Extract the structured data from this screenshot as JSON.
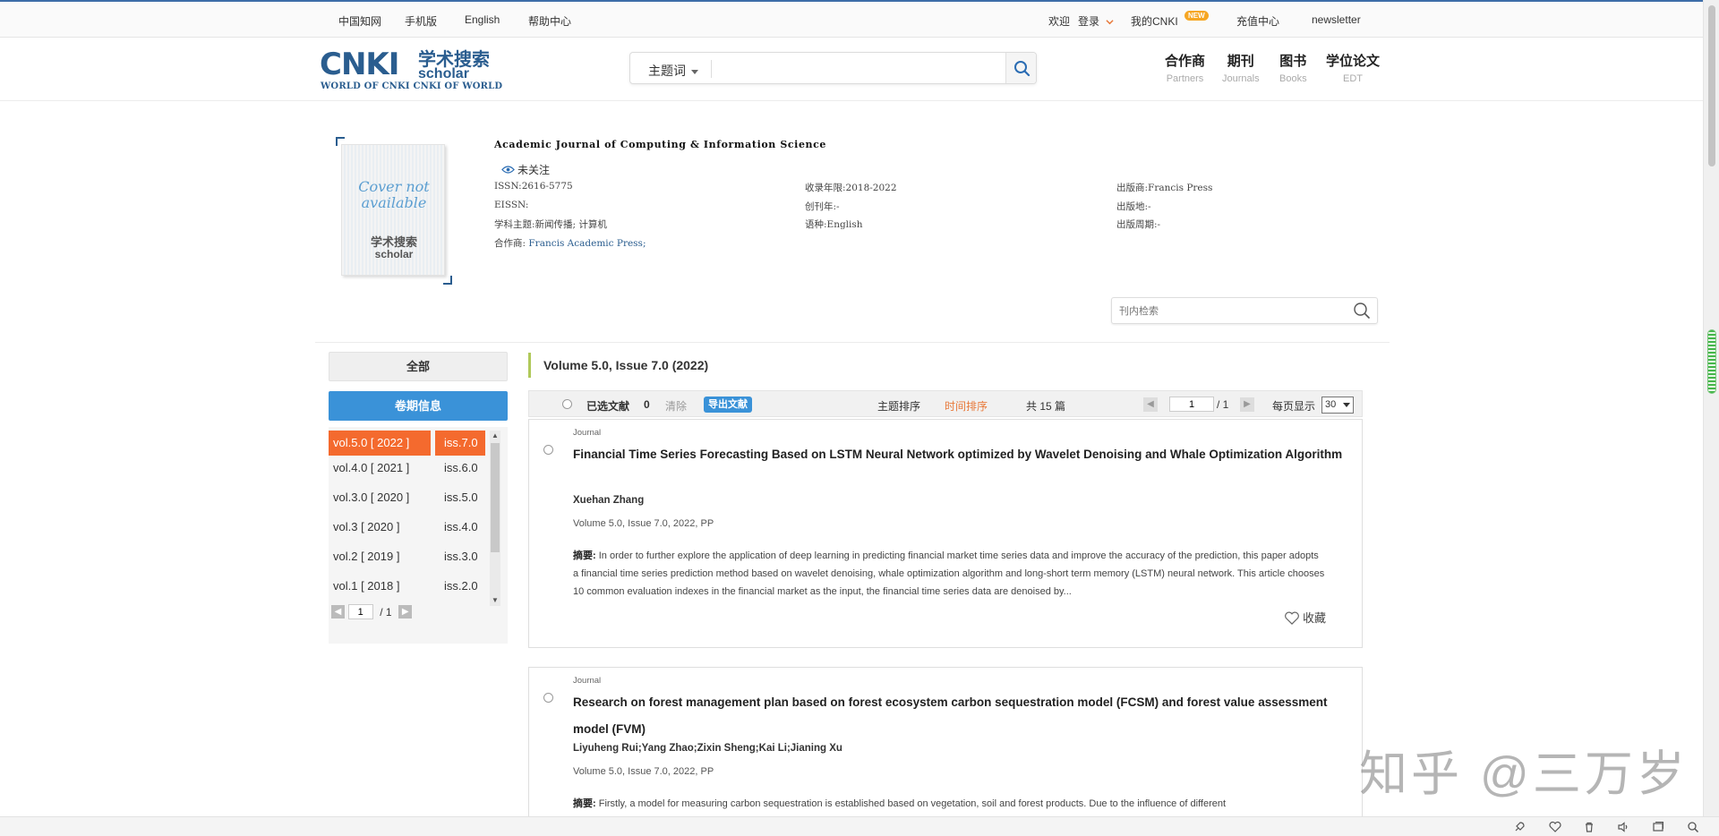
{
  "topbar": {
    "links": [
      "中国知网",
      "手机版",
      "English",
      "帮助中心"
    ],
    "welcome": "欢迎",
    "login": "登录",
    "my_cnki": "我的CNKI",
    "new_badge": "NEW",
    "recharge": "充值中心",
    "newsletter": "newsletter"
  },
  "header": {
    "logo_main": "CNKI",
    "logo_cn": "学术搜索",
    "logo_scholar": "scholar",
    "logo_sub": "WORLD OF CNKI CNKI OF WORLD",
    "search_type": "主题词",
    "search_value": "",
    "nav": [
      {
        "cn": "合作商",
        "en": "Partners"
      },
      {
        "cn": "期刊",
        "en": "Journals"
      },
      {
        "cn": "图书",
        "en": "Books"
      },
      {
        "cn": "学位论文",
        "en": "EDT"
      }
    ]
  },
  "journal": {
    "cover_text": "Cover not available",
    "cover_logo_cn": "学术搜索",
    "cover_logo_en": "scholar",
    "title": "Academic Journal of Computing & Information Science",
    "follow": "未关注",
    "issn": "ISSN:2616-5775",
    "eissn": "EISSN:",
    "subject": "学科主题:新闻传播; 计算机",
    "partner_label": "合作商:",
    "partner_value": "Francis Academic Press;",
    "years": "收录年限:2018-2022",
    "founded": "创刊年:-",
    "language": "语种:English",
    "publisher": "出版商:Francis Press",
    "place": "出版地:-",
    "period": "出版周期:-",
    "inner_search_placeholder": "刊内检索"
  },
  "sidebar": {
    "all": "全部",
    "info": "卷期信息",
    "volumes": [
      "vol.5.0 [ 2022 ]",
      "vol.4.0 [ 2021 ]",
      "vol.3.0 [ 2020 ]",
      "vol.3 [ 2020 ]",
      "vol.2 [ 2019 ]",
      "vol.1 [ 2018 ]"
    ],
    "issues": [
      "iss.7.0",
      "iss.6.0",
      "iss.5.0",
      "iss.4.0",
      "iss.3.0",
      "iss.2.0"
    ],
    "page_current": "1",
    "page_total": "/ 1"
  },
  "main": {
    "volume_heading": "Volume 5.0, Issue 7.0 (2022)",
    "toolbar": {
      "selected_label": "已选文献",
      "selected_count": "0",
      "clear": "清除",
      "export": "导出文献",
      "sort_topic": "主题排序",
      "sort_time": "时间排序",
      "total": "共 15 篇",
      "page_current": "1",
      "page_total": "/ 1",
      "per_page_label": "每页显示",
      "per_page_value": "30"
    },
    "articles": [
      {
        "type": "Journal",
        "title": "Financial Time Series Forecasting Based on LSTM Neural Network optimized by Wavelet Denoising and Whale Optimization Algorithm",
        "authors": "Xuehan Zhang",
        "volume_info": "Volume 5.0, Issue 7.0, 2022, PP",
        "abstract_label": "摘要:",
        "abstract": " In order to further explore the application of deep learning in predicting financial market time series data and improve the accuracy of the prediction, this paper adopts a financial time series prediction method based on wavelet denoising, whale optimization algorithm and long-short term memory (LSTM) neural network. This article chooses 10 common evaluation indexes in the financial market as the input, the financial time series data are denoised by...",
        "fav": "收藏"
      },
      {
        "type": "Journal",
        "title": "Research on forest management plan based on forest ecosystem carbon sequestration model (FCSM) and forest value assessment model (FVM)",
        "authors": "Liyuheng Rui;Yang Zhao;Zixin Sheng;Kai Li;Jianing Xu",
        "volume_info": "Volume 5.0, Issue 7.0, 2022, PP",
        "abstract_label": "摘要:",
        "abstract": " Firstly, a model for measuring carbon sequestration is established based on vegetation, soil and forest products. Due to the influence of different"
      }
    ]
  },
  "watermark": "知乎 @三万岁",
  "colors": {
    "brand_blue": "#2a5d8f",
    "accent_blue": "#3a92d8",
    "active_orange": "#f46a2e",
    "sort_orange": "#e8793a"
  }
}
